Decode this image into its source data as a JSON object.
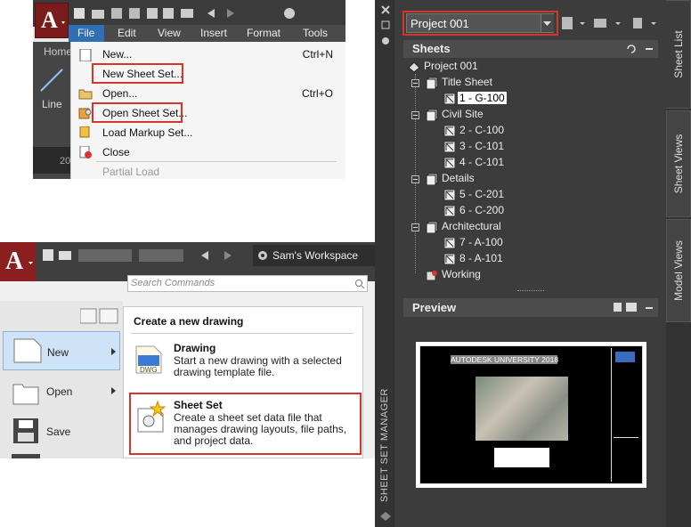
{
  "file_menu": {
    "ribbon_tabs": [
      "Home"
    ],
    "menubar": [
      "File",
      "Edit",
      "View",
      "Insert",
      "Format",
      "Tools"
    ],
    "left_tool_label": "Line",
    "left_tab_label": "20",
    "items": [
      {
        "label": "New...",
        "shortcut": "Ctrl+N"
      },
      {
        "label": "New Sheet Set...",
        "shortcut": ""
      },
      {
        "label": "Open...",
        "shortcut": "Ctrl+O"
      },
      {
        "label": "Open Sheet Set...",
        "shortcut": ""
      },
      {
        "label": "Load Markup Set...",
        "shortcut": ""
      },
      {
        "label": "Close",
        "shortcut": ""
      },
      {
        "label": "Partial Load",
        "shortcut": ""
      }
    ]
  },
  "app_menu": {
    "workspace": "Sam's Workspace",
    "search_placeholder": "Search Commands",
    "left_items": [
      "New",
      "Open",
      "Save"
    ],
    "panel_title": "Create a new drawing",
    "options": [
      {
        "title": "Drawing",
        "description_lines": [
          "Start a new drawing with a selected",
          "drawing template file."
        ],
        "icon_label": "DWG"
      },
      {
        "title": "Sheet Set",
        "description_lines": [
          "Create a sheet set data file that",
          "manages drawing layouts, file paths,",
          "and project data."
        ]
      }
    ]
  },
  "ssm": {
    "project": "Project 001",
    "sheets_header": "Sheets",
    "preview_header": "Preview",
    "vertical_title": "SHEET SET MANAGER",
    "tabs": [
      "Sheet List",
      "Sheet Views",
      "Model Views"
    ],
    "root": "Project 001",
    "tree": [
      {
        "name": "Title Sheet",
        "sheets": [
          "1 - G-100"
        ]
      },
      {
        "name": "Civil Site",
        "sheets": [
          "2 - C-100",
          "3 - C-101",
          "4 - C-101"
        ]
      },
      {
        "name": "Details",
        "sheets": [
          "5 - C-201",
          "6 - C-200"
        ]
      },
      {
        "name": "Architectural",
        "sheets": [
          "7 - A-100",
          "8 - A-101"
        ]
      }
    ],
    "working": "Working",
    "preview_banner": "AUTODESK UNIVERSITY 2018",
    "selected_sheet": "1 - G-100"
  },
  "colors": {
    "highlight_box": "#d9342b",
    "panel_dark": "#3c3c3c",
    "selection_bg": "#ffffff"
  }
}
